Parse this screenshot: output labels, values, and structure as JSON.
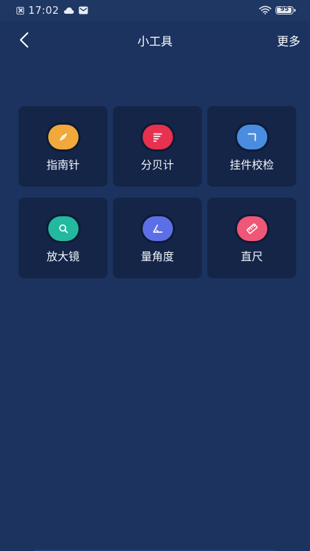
{
  "status_bar": {
    "time": "17:02",
    "battery": "95",
    "battery_level": 0.95
  },
  "header": {
    "title": "小工具",
    "more_label": "更多"
  },
  "tools": [
    {
      "label": "指南针",
      "icon": "compass-icon",
      "color": "#f0a93a"
    },
    {
      "label": "分贝计",
      "icon": "decibel-icon",
      "color": "#e8304f"
    },
    {
      "label": "挂件校检",
      "icon": "corner-level-icon",
      "color": "#4a8de0"
    },
    {
      "label": "放大镜",
      "icon": "magnifier-icon",
      "color": "#22b9a0"
    },
    {
      "label": "量角度",
      "icon": "protractor-icon",
      "color": "#5c6fe6"
    },
    {
      "label": "直尺",
      "icon": "ruler-icon",
      "color": "#ef5776"
    }
  ]
}
